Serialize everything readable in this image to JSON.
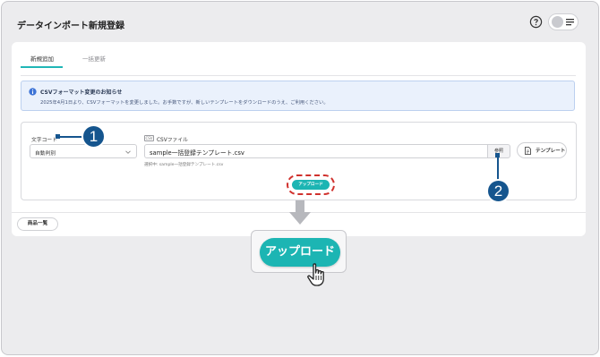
{
  "header": {
    "title": "データインポート新規登録",
    "help_icon": "question-circle-icon",
    "user_avatar_icon": "avatar",
    "menu_icon": "hamburger-icon"
  },
  "tabs": [
    {
      "label": "新規追加",
      "active": true
    },
    {
      "label": "一括更新",
      "active": false
    }
  ],
  "notice": {
    "icon": "info-icon",
    "title": "CSVフォーマット変更のお知らせ",
    "body": "2025年4月1日より、CSVフォーマットを変更しました。お手数ですが、新しいテンプレートをダウンロードのうえ、ご利用ください。"
  },
  "form": {
    "encoding_label": "文字コード",
    "encoding_value": "自動判別",
    "csv_file_label": "CSVファイル",
    "file_name": "sample一括登録テンプレート.csv",
    "browse_label": "参照",
    "selected_note": "選択中: sample一括登録テンプレート.csv",
    "template_label": "テンプレート",
    "upload_label": "アップロード"
  },
  "catalog_button": "商品一覧",
  "callouts": [
    "1",
    "2"
  ],
  "zoom": {
    "upload_label": "アップロード",
    "cursor_icon": "hand-pointer-icon"
  },
  "colors": {
    "accent": "#1cb5b3",
    "callout": "#15558e",
    "highlight": "#d0312d",
    "notice_bg": "#eaf1fc"
  }
}
